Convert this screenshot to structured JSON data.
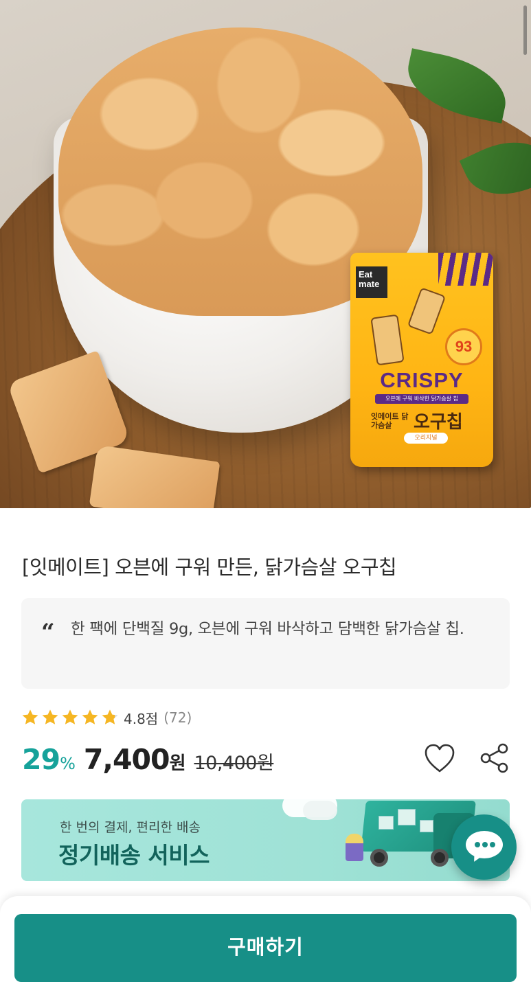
{
  "product": {
    "title": "[잇메이트] 오븐에 구워 만든, 닭가슴살 오구칩",
    "quote": "한 팩에 단백질 9g, 오븐에 구워 바삭하고 담백한 닭가슴살 칩.",
    "rating": {
      "stars": 4.8,
      "score_label": "4.8점",
      "count_label": "(72)"
    },
    "price": {
      "discount": "29",
      "discount_unit": "%",
      "sale": "7,400",
      "sale_unit": "원",
      "original": "10,400원"
    },
    "pack": {
      "logo": "Eat mate",
      "crispy": "CRISPY",
      "band": "오븐에 구워 바삭한 닭가슴살 칩",
      "brand": "잇메이트 닭가슴살",
      "name": "오구칩",
      "pill": "오리지널",
      "badge": "93"
    }
  },
  "banner": {
    "subtitle": "한 번의 결제, 편리한 배송",
    "title": "정기배송 서비스"
  },
  "actions": {
    "buy_label": "구매하기"
  },
  "icons": {
    "wishlist": "heart-icon",
    "share": "share-icon",
    "chat": "chat-icon",
    "quote": "quote-icon",
    "star": "star-icon"
  },
  "colors": {
    "accent": "#178f87",
    "discount": "#16a29a",
    "star": "#f5b623",
    "banner_bg": "#a7e6dc"
  }
}
